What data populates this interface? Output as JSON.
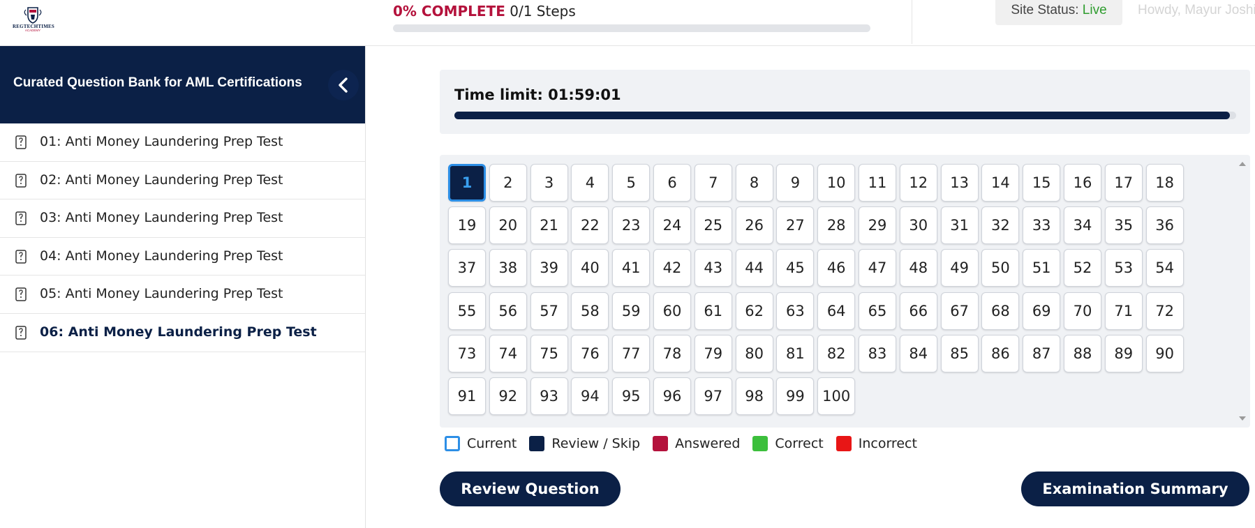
{
  "header": {
    "logo_text": "REGTECHTIMES",
    "logo_subtext": "ACADEMY",
    "progress_percent_label": "0% COMPLETE",
    "progress_steps": "0/1 Steps",
    "progress_fraction": 0,
    "site_status_label": "Site Status:",
    "site_status_value": "Live",
    "howdy": "Howdy, Mayur Joshi"
  },
  "sidebar": {
    "title": "Curated Question Bank for AML Certifications",
    "lessons": [
      {
        "label": "01: Anti Money Laundering Prep Test"
      },
      {
        "label": "02: Anti Money Laundering Prep Test"
      },
      {
        "label": "03: Anti Money Laundering Prep Test"
      },
      {
        "label": "04: Anti Money Laundering Prep Test"
      },
      {
        "label": "05: Anti Money Laundering Prep Test"
      },
      {
        "label": "06: Anti Money Laundering Prep Test"
      }
    ],
    "active_index": 5
  },
  "quiz": {
    "time_limit_label": "Time limit: 01:59:01",
    "time_remaining_fraction": 0.992,
    "question_count": 100,
    "current_question": 1,
    "columns": 18,
    "legend": {
      "current": "Current",
      "review": "Review / Skip",
      "answered": "Answered",
      "correct": "Correct",
      "incorrect": "Incorrect"
    },
    "review_button": "Review Question",
    "summary_button": "Examination Summary"
  },
  "colors": {
    "navy": "#0b2046",
    "crimson": "#b4123c",
    "current_border": "#2d8fe6",
    "correct": "#3cbf3c",
    "incorrect": "#e81616",
    "live": "#2e9c2e"
  }
}
